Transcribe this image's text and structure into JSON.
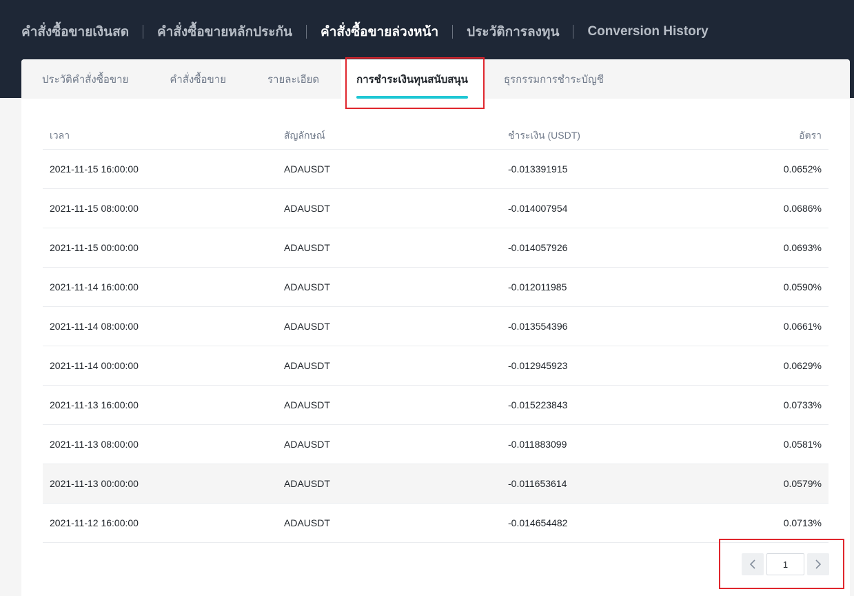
{
  "main_nav": {
    "tabs": [
      {
        "label": "คำสั่งซื้อขายเงินสด",
        "active": false
      },
      {
        "label": "คำสั่งซื้อขายหลักประกัน",
        "active": false
      },
      {
        "label": "คำสั่งซื้อขายล่วงหน้า",
        "active": true
      },
      {
        "label": "ประวัติการลงทุน",
        "active": false
      },
      {
        "label": "Conversion History",
        "active": false
      }
    ]
  },
  "sub_nav": {
    "tabs": [
      {
        "label": "ประวัติคำสั่งซื้อขาย",
        "active": false
      },
      {
        "label": "คำสั่งซื้อขาย",
        "active": false
      },
      {
        "label": "รายละเอียด",
        "active": false
      },
      {
        "label": "การชำระเงินทุนสนับสนุน",
        "active": true
      },
      {
        "label": "ธุรกรรมการชำระบัญชี",
        "active": false
      }
    ]
  },
  "table": {
    "headers": {
      "time": "เวลา",
      "symbol": "สัญลักษณ์",
      "payment": "ชำระเงิน (USDT)",
      "rate": "อัตรา"
    },
    "rows": [
      {
        "time": "2021-11-15 16:00:00",
        "symbol": "ADAUSDT",
        "payment": "-0.013391915",
        "rate": "0.0652%"
      },
      {
        "time": "2021-11-15 08:00:00",
        "symbol": "ADAUSDT",
        "payment": "-0.014007954",
        "rate": "0.0686%"
      },
      {
        "time": "2021-11-15 00:00:00",
        "symbol": "ADAUSDT",
        "payment": "-0.014057926",
        "rate": "0.0693%"
      },
      {
        "time": "2021-11-14 16:00:00",
        "symbol": "ADAUSDT",
        "payment": "-0.012011985",
        "rate": "0.0590%"
      },
      {
        "time": "2021-11-14 08:00:00",
        "symbol": "ADAUSDT",
        "payment": "-0.013554396",
        "rate": "0.0661%"
      },
      {
        "time": "2021-11-14 00:00:00",
        "symbol": "ADAUSDT",
        "payment": "-0.012945923",
        "rate": "0.0629%"
      },
      {
        "time": "2021-11-13 16:00:00",
        "symbol": "ADAUSDT",
        "payment": "-0.015223843",
        "rate": "0.0733%"
      },
      {
        "time": "2021-11-13 08:00:00",
        "symbol": "ADAUSDT",
        "payment": "-0.011883099",
        "rate": "0.0581%"
      },
      {
        "time": "2021-11-13 00:00:00",
        "symbol": "ADAUSDT",
        "payment": "-0.011653614",
        "rate": "0.0579%",
        "hovered": true
      },
      {
        "time": "2021-11-12 16:00:00",
        "symbol": "ADAUSDT",
        "payment": "-0.014654482",
        "rate": "0.0713%"
      }
    ]
  },
  "pagination": {
    "page": "1",
    "prev_icon": "chevron-left-icon",
    "next_icon": "chevron-right-icon"
  },
  "colors": {
    "header_bg": "#1e2736",
    "accent": "#1fc7d4",
    "highlight_box": "#e0262d"
  }
}
